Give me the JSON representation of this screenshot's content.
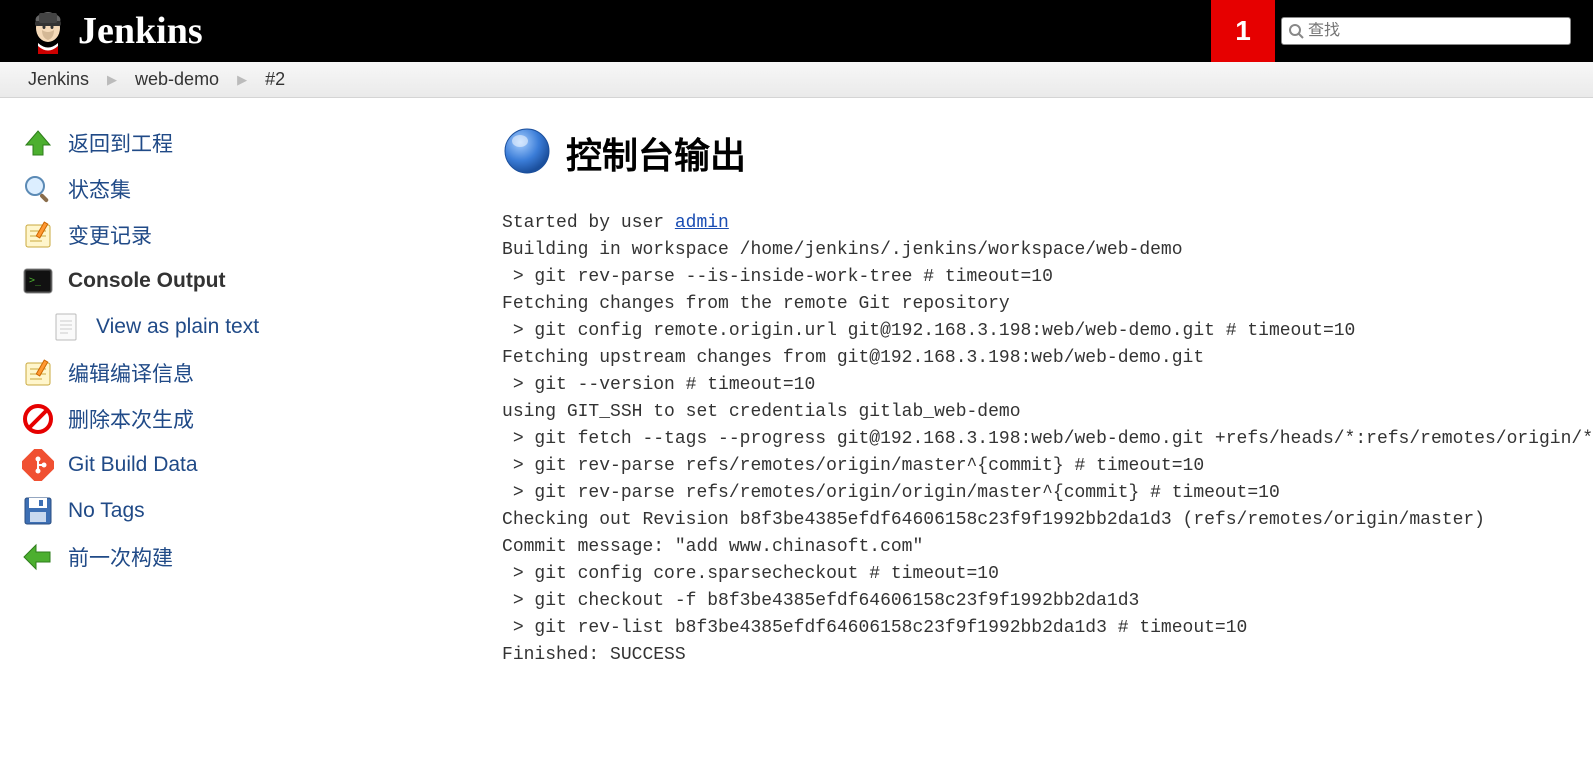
{
  "header": {
    "logo_text": "Jenkins",
    "notification_count": "1",
    "search_placeholder": "查找"
  },
  "breadcrumb": {
    "items": [
      "Jenkins",
      "web-demo",
      "#2"
    ]
  },
  "sidebar": {
    "back_to_project": "返回到工程",
    "status": "状态集",
    "changes": "变更记录",
    "console_output": "Console Output",
    "view_as_plain_text": "View as plain text",
    "edit_build_info": "编辑编译信息",
    "delete_build": "删除本次生成",
    "git_build_data": "Git Build Data",
    "no_tags": "No Tags",
    "previous_build": "前一次构建"
  },
  "main": {
    "title": "控制台输出",
    "started_by_prefix": "Started by user ",
    "started_by_user": "admin",
    "console_lines": [
      "Building in workspace /home/jenkins/.jenkins/workspace/web-demo",
      " > git rev-parse --is-inside-work-tree # timeout=10",
      "Fetching changes from the remote Git repository",
      " > git config remote.origin.url git@192.168.3.198:web/web-demo.git # timeout=10",
      "Fetching upstream changes from git@192.168.3.198:web/web-demo.git",
      " > git --version # timeout=10",
      "using GIT_SSH to set credentials gitlab_web-demo",
      " > git fetch --tags --progress git@192.168.3.198:web/web-demo.git +refs/heads/*:refs/remotes/origin/*",
      " > git rev-parse refs/remotes/origin/master^{commit} # timeout=10",
      " > git rev-parse refs/remotes/origin/origin/master^{commit} # timeout=10",
      "Checking out Revision b8f3be4385efdf64606158c23f9f1992bb2da1d3 (refs/remotes/origin/master)",
      "Commit message: \"add www.chinasoft.com\"",
      " > git config core.sparsecheckout # timeout=10",
      " > git checkout -f b8f3be4385efdf64606158c23f9f1992bb2da1d3",
      " > git rev-list b8f3be4385efdf64606158c23f9f1992bb2da1d3 # timeout=10",
      "Finished: SUCCESS"
    ]
  }
}
